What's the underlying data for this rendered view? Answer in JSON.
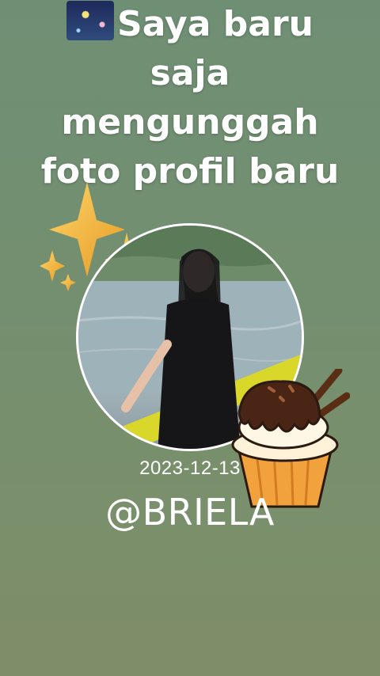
{
  "headline": {
    "icon": "fireworks-emoji",
    "lines": [
      "Saya baru",
      "saja",
      "mengunggah",
      "foto profil baru"
    ]
  },
  "profile": {
    "date": "2023-12-13",
    "username": "@BRIELA"
  },
  "decorations": {
    "sparkle_icon": "sparkles-icon",
    "cupcake_icon": "cupcake-sticker",
    "sparkle_color": "#f2b53c",
    "frame_color": "#ffffff"
  }
}
